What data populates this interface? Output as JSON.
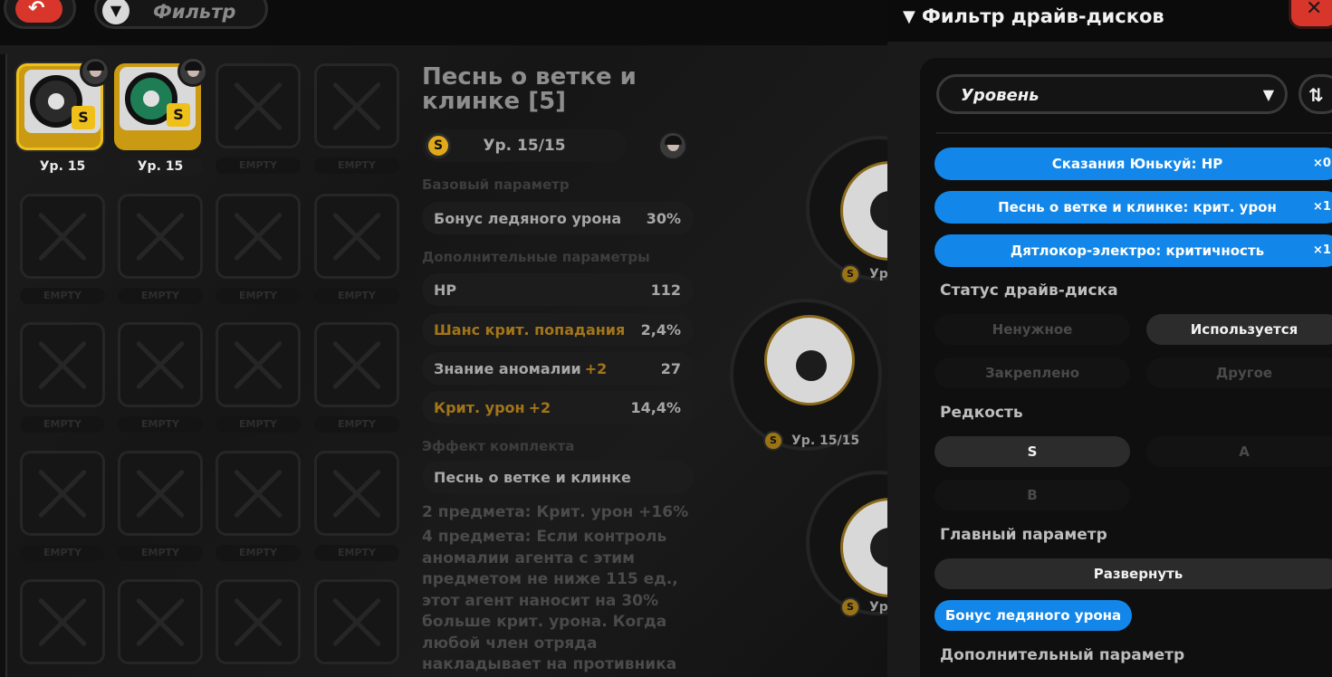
{
  "topbar": {
    "back_icon": "back-arrow-icon",
    "filter_label": "Фильтр",
    "filter_icon": "funnel-icon"
  },
  "grid": {
    "discs": [
      {
        "level": "Ур. 15",
        "selected": true
      },
      {
        "level": "Ур. 15",
        "selected": false
      }
    ],
    "empty_label": "EMPTY"
  },
  "detail": {
    "title": "Песнь о ветке и клинке [5]",
    "level": "Ур. 15/15",
    "base_label": "Базовый параметр",
    "base_stat": {
      "name": "Бонус ледяного урона",
      "value": "30%"
    },
    "extra_label": "Дополнительные параметры",
    "extra_stats": [
      {
        "name": "HP",
        "bonus": "",
        "value": "112",
        "highlight": false
      },
      {
        "name": "Шанс крит. попадания",
        "bonus": "",
        "value": "2,4%",
        "highlight": true
      },
      {
        "name": "Знание аномалии",
        "bonus": "+2",
        "value": "27",
        "highlight": false
      },
      {
        "name": "Крит. урон",
        "bonus": "+2",
        "value": "14,4%",
        "highlight": true
      }
    ],
    "set_label": "Эффект комплекта",
    "set_name": "Песнь о ветке и клинке",
    "set_desc_2": "2 предмета: Крит. урон +16%",
    "set_desc_4": "4 предмета: Если контроль аномалии агента с этим предметом не ниже 115 ед., этот агент наносит на 30% больше крит. урона. Когда любой член отряда накладывает на противника"
  },
  "center_discs": {
    "level_main": "Ур. 15/15",
    "level_short": "Ур"
  },
  "panel": {
    "title": "Фильтр драйв-дисков",
    "close_label": "✕",
    "sort_label": "Уровень",
    "sort_dir": "⇅",
    "chips": [
      {
        "text": "Сказания Юнькуй: HP",
        "count": "×0"
      },
      {
        "text": "Песнь о ветке и клинке: крит. урон",
        "count": "×1"
      },
      {
        "text": "Дятлокор-электро: критичность",
        "count": "×1"
      }
    ],
    "status_label": "Статус драйв-диска",
    "status_options": [
      "Ненужное",
      "Используется",
      "Закреплено",
      "Другое"
    ],
    "rarity_label": "Редкость",
    "rarity_options": [
      "S",
      "A",
      "B"
    ],
    "main_label": "Главный параметр",
    "expand_label": "Развернуть",
    "main_selected": "Бонус ледяного урона",
    "sub_label": "Дополнительный параметр"
  },
  "colors": {
    "accent_blue": "#1387e9",
    "gold": "#c99a12",
    "close_red": "#d8362b"
  }
}
